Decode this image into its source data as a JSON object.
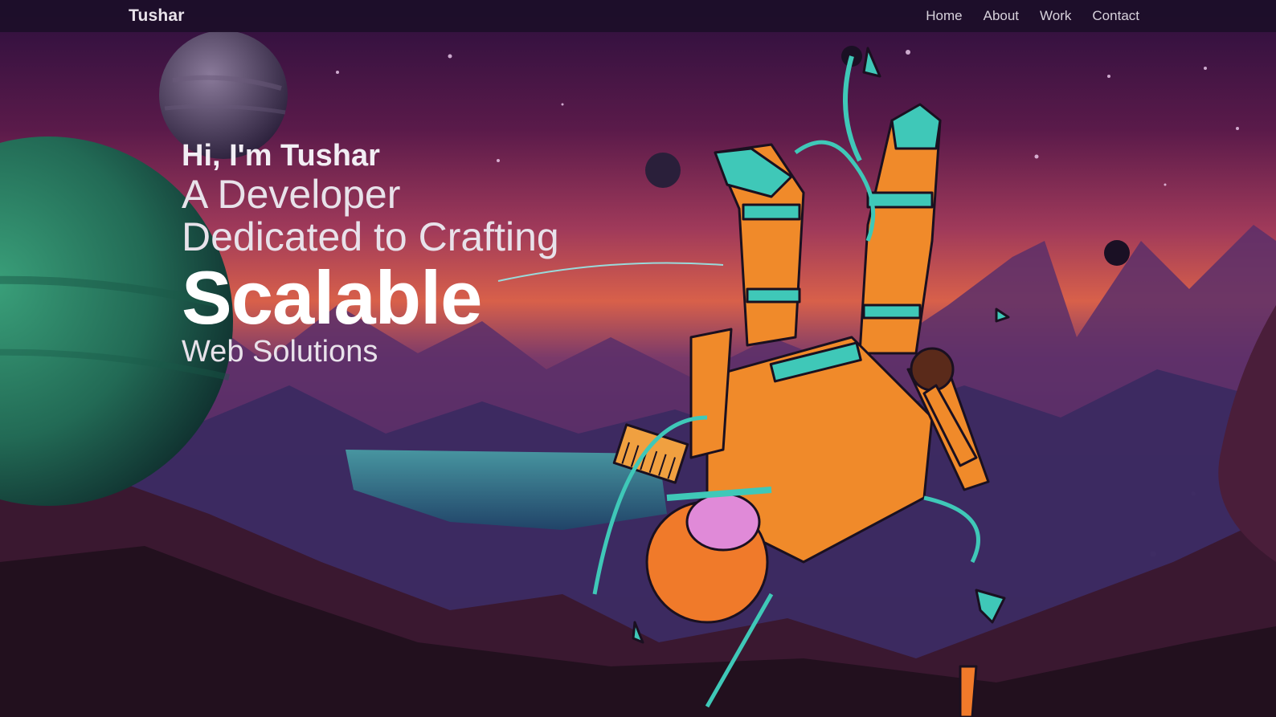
{
  "nav": {
    "brand": "Tushar",
    "links": [
      "Home",
      "About",
      "Work",
      "Contact"
    ]
  },
  "hero": {
    "greeting": "Hi, I'm Tushar",
    "line2": "A Developer",
    "line3": "Dedicated to Crafting",
    "highlight": "Scalable",
    "line5": "Web Solutions"
  },
  "colors": {
    "sky_top": "#2a0f3d",
    "sky_mid": "#8a2a5a",
    "horizon": "#e0604a",
    "teal": "#3fc8b8",
    "suit_orange": "#f07a2a",
    "planet_green": "#2f8a6a"
  },
  "illustration": {
    "subject": "astronaut-floating-icon",
    "background": "alien-landscape-icon"
  }
}
